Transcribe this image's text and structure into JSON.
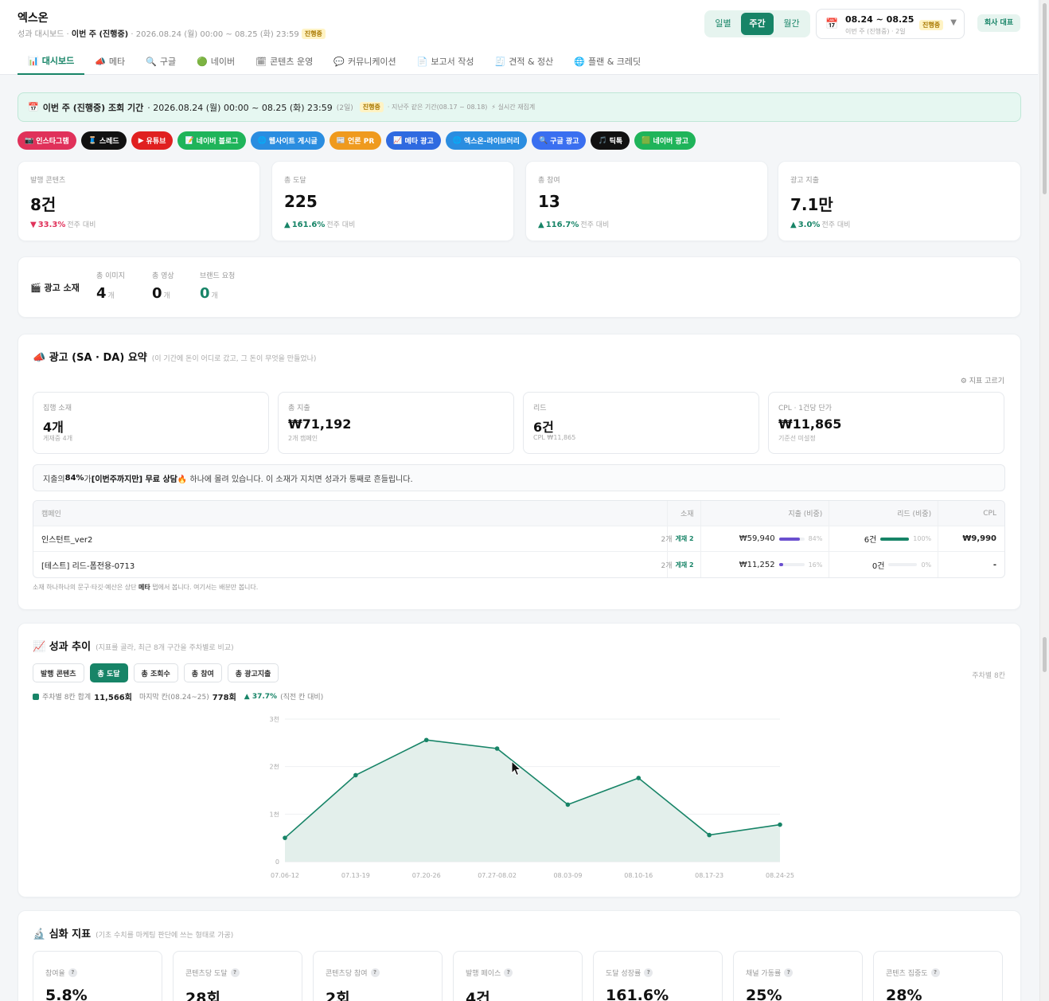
{
  "header": {
    "brand": "엑스온",
    "sub_prefix": "성과 대시보드 · ",
    "sub_period": "이번 주 (진행중)",
    "sub_range": " · 2026.08.24 (월) 00:00 ~ 08.25 (화) 23:59",
    "status_badge": "진행중"
  },
  "period_toggle": {
    "daily": "일별",
    "weekly": "주간",
    "monthly": "월간"
  },
  "date_picker": {
    "range": "08.24 ~ 08.25",
    "sub": "이번 주 (진행중) · 2일",
    "badge": "진행중"
  },
  "company_button": "회사 대표",
  "tabs": [
    {
      "icon": "📊",
      "label": "대시보드"
    },
    {
      "icon": "📣",
      "label": "메타"
    },
    {
      "icon": "🔍",
      "label": "구글"
    },
    {
      "icon": "🟢",
      "label": "네이버"
    },
    {
      "icon": "🗓",
      "label": "콘텐츠 운영"
    },
    {
      "icon": "💬",
      "label": "커뮤니케이션"
    },
    {
      "icon": "📄",
      "label": "보고서 작성"
    },
    {
      "icon": "🧾",
      "label": "견적 & 정산"
    },
    {
      "icon": "🌐",
      "label": "플랜 & 크레딧"
    }
  ],
  "period_bar": {
    "icon": "📅",
    "label": "이번 주 (진행중) 조회 기간",
    "range": " · 2026.08.24 (월) 00:00 ~ 08.25 (화) 23:59",
    "days": "(2일)",
    "badge": "진행중",
    "compare": "· 지난주 같은 기간(08.17 ~ 08.18)",
    "realtime": "⚡ 실시간 재집계"
  },
  "channels": [
    {
      "icon": "📷",
      "label": "인스타그램",
      "color": "#e0315a"
    },
    {
      "icon": "🧵",
      "label": "스레드",
      "color": "#111111"
    },
    {
      "icon": "▶",
      "label": "유튜브",
      "color": "#e02020"
    },
    {
      "icon": "📝",
      "label": "네이버 블로그",
      "color": "#1fb45a"
    },
    {
      "icon": "🌐",
      "label": "웹사이트 게시글",
      "color": "#2a8de0"
    },
    {
      "icon": "📰",
      "label": "언론 PR",
      "color": "#ef9a1e"
    },
    {
      "icon": "📈",
      "label": "메타 광고",
      "color": "#2f6ae0"
    },
    {
      "icon": "🌐",
      "label": "엑스온-라이브러리",
      "color": "#2a8de0"
    },
    {
      "icon": "🔍",
      "label": "구글 광고",
      "color": "#3a6ff0"
    },
    {
      "icon": "🎵",
      "label": "틱톡",
      "color": "#111111"
    },
    {
      "icon": "🟩",
      "label": "네이버 광고",
      "color": "#1fb45a"
    }
  ],
  "kpis": [
    {
      "label": "발행 콘텐츠",
      "value": "8건",
      "arrow": "▼",
      "delta": "33.3%",
      "dir": "down",
      "cmp": "전주 대비"
    },
    {
      "label": "총 도달",
      "value": "225",
      "arrow": "▲",
      "delta": "161.6%",
      "dir": "up",
      "cmp": "전주 대비"
    },
    {
      "label": "총 참여",
      "value": "13",
      "arrow": "▲",
      "delta": "116.7%",
      "dir": "up",
      "cmp": "전주 대비"
    },
    {
      "label": "광고 지출",
      "value": "7.1만",
      "arrow": "▲",
      "delta": "3.0%",
      "dir": "up",
      "cmp": "전주 대비"
    }
  ],
  "ad_assets": {
    "title": "🎬 광고 소재",
    "stats": [
      {
        "label": "총 이미지",
        "value": "4",
        "unit": "개"
      },
      {
        "label": "총 영상",
        "value": "0",
        "unit": "개"
      },
      {
        "label": "브랜드 요청",
        "value": "0",
        "unit": "개"
      }
    ]
  },
  "ad_summary": {
    "title": "📣 광고 (SA · DA) 요약",
    "hint": "(이 기간에 돈이 어디로 갔고, 그 돈이 무엇을 만들었나)",
    "pick": "⚙ 지표 고르기",
    "cards": [
      {
        "label": "집행 소재",
        "value": "4개",
        "sub": "게재중 4개"
      },
      {
        "label": "총 지출",
        "value": "₩71,192",
        "sub": "2개 캠페인"
      },
      {
        "label": "리드",
        "value": "6건",
        "sub": "CPL ₩11,865"
      },
      {
        "label": "CPL · 1건당 단가",
        "value": "₩11,865",
        "sub": "기준선 미설정"
      }
    ],
    "notice": {
      "a": "지출의 ",
      "pct": "84%",
      "b": "가 ",
      "campaign": "[이번주까지만] 무료 상담",
      "c": "🔥 하나에 몰려 있습니다. 이 소재가 지치면 성과가 통째로 흔들립니다."
    },
    "table": {
      "headers": [
        "캠페인",
        "소재",
        "지출 (비중)",
        "리드 (비중)",
        "CPL"
      ],
      "rows": [
        {
          "name": "인스턴트_ver2",
          "count": "2개",
          "live": "게재 2",
          "spend": "₩59,940",
          "spend_share": 84,
          "spend_pct": "84%",
          "leads": "6건",
          "lead_share": 100,
          "lead_pct": "100%",
          "cpl": "₩9,990"
        },
        {
          "name": "[테스트] 리드-폼전용-0713",
          "count": "2개",
          "live": "게재 2",
          "spend": "₩11,252",
          "spend_share": 16,
          "spend_pct": "16%",
          "leads": "0건",
          "lead_share": 0,
          "lead_pct": "0%",
          "cpl": "-"
        }
      ]
    },
    "footnote_a": "소재 하나하나의 문구·타깃·예산은 상단 ",
    "footnote_b": "메타",
    "footnote_c": " 탭에서 봅니다. 여기서는 배분만 봅니다."
  },
  "trend": {
    "title": "📈 성과 추이",
    "hint": "(지표를 골라, 최근 8개 구간을 주차별로 비교)",
    "metric_tabs": [
      "발행 콘텐츠",
      "총 도달",
      "총 조회수",
      "총 참여",
      "총 광고지출"
    ],
    "active_tab": 1,
    "weekly_label": "주차별 8칸",
    "legend": {
      "total_label": "주차별 8칸 합계",
      "total": "11,566회",
      "last_label": "마지막 칸(08.24~25)",
      "last": "778회",
      "change": "▲ 37.7%",
      "change_note": "(직전 칸 대비)"
    }
  },
  "chart_data": {
    "type": "area",
    "x": [
      "07.06-12",
      "07.13-19",
      "07.20-26",
      "07.27-08.02",
      "08.03-09",
      "08.10-16",
      "08.17-23",
      "08.24-25"
    ],
    "series": [
      {
        "values": [
          500,
          1820,
          2560,
          2380,
          1200,
          1760,
          560,
          778
        ]
      }
    ],
    "y_ticks": [
      "0",
      "1천",
      "2천",
      "3천"
    ],
    "ylim": [
      0,
      3000
    ],
    "color": "#178467",
    "fill": "#e3efeb",
    "grid": true
  },
  "deep": {
    "title": "🔬 심화 지표",
    "hint": "(기초 수치를 마케팅 판단에 쓰는 형태로 가공)",
    "cards": [
      {
        "label": "참여율",
        "value": "5.8%"
      },
      {
        "label": "콘텐츠당 도달",
        "value": "28회"
      },
      {
        "label": "콘텐츠당 참여",
        "value": "2회"
      },
      {
        "label": "발행 페이스",
        "value": "4건"
      },
      {
        "label": "도달 성장률",
        "value": "161.6%"
      },
      {
        "label": "채널 가동률",
        "value": "25%"
      },
      {
        "label": "콘텐츠 집중도",
        "value": "28%"
      }
    ]
  }
}
